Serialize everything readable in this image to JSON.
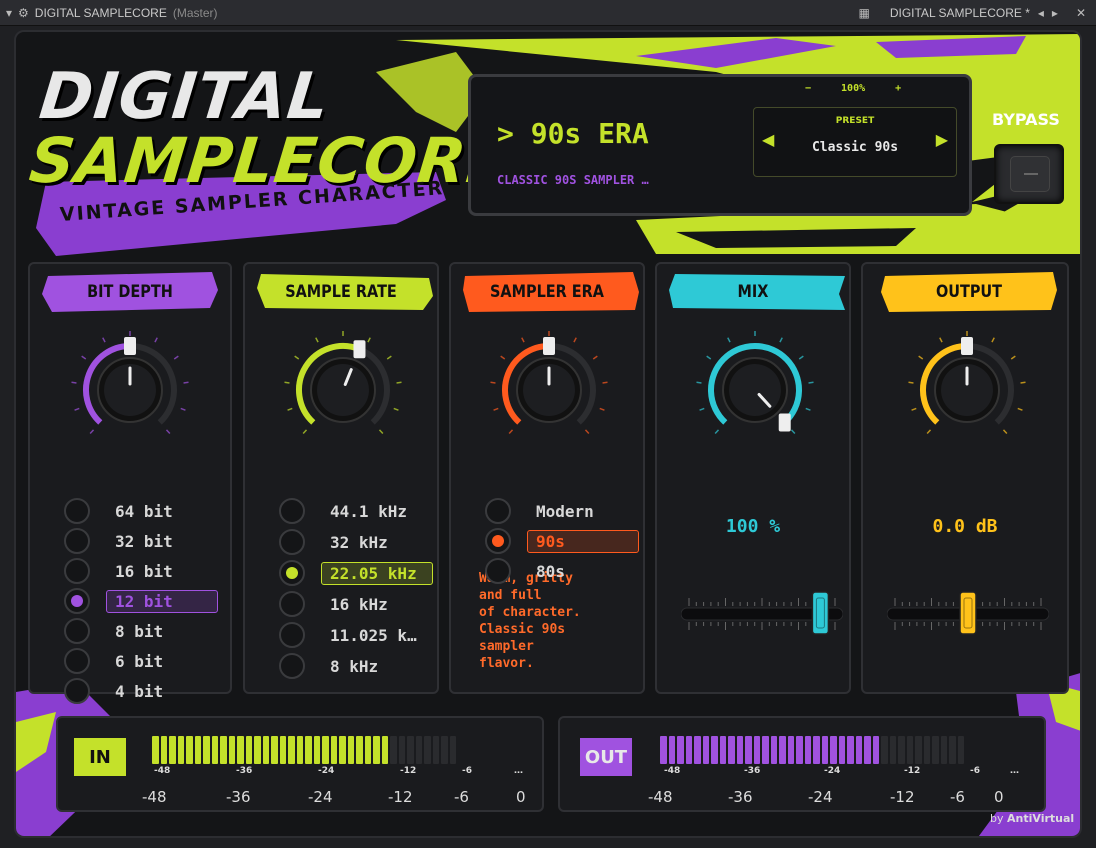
{
  "window": {
    "title": "DIGITAL SAMPLECORE",
    "title_suffix": "(Master)",
    "right_title": "DIGITAL SAMPLECORE *",
    "icons": [
      "menu-triangle-icon",
      "gear-icon",
      "grid-icon",
      "prev-arrow-icon",
      "next-arrow-icon",
      "close-icon"
    ]
  },
  "brand": {
    "line1": "DIGITAL",
    "line2": "SAMPLECORE",
    "tagline": "VINTAGE SAMPLER CHARACTER",
    "credit_prefix": "by ",
    "credit_name": "AntiVirtual"
  },
  "display": {
    "zoom_minus": "−",
    "zoom_value": "100%",
    "zoom_plus": "+",
    "era_title": "> 90s ERA",
    "era_subtitle": "CLASSIC 90S SAMPLER …",
    "preset_label": "PRESET",
    "preset_value": "Classic 90s"
  },
  "bypass": {
    "label": "BYPASS",
    "state": "off"
  },
  "colors": {
    "lime": "#c4e12a",
    "purple": "#a052e0",
    "orange": "#ff5a1e",
    "cyan": "#2ec9d6",
    "gold": "#ffc21a"
  },
  "panels": {
    "bit_depth": {
      "title": "BIT DEPTH",
      "knob_value": 0.5,
      "options": [
        "64 bit",
        "32 bit",
        "16 bit",
        "12 bit",
        "8 bit",
        "6 bit",
        "4 bit"
      ],
      "selected": 3
    },
    "sample_rate": {
      "title": "SAMPLE RATE",
      "knob_value": 0.58,
      "options": [
        "44.1 kHz",
        "32 kHz",
        "22.05 kHz",
        "16 kHz",
        "11.025 k…",
        "8 kHz"
      ],
      "selected": 2
    },
    "sampler_era": {
      "title": "SAMPLER ERA",
      "knob_value": 0.5,
      "options": [
        "Modern",
        "90s",
        "80s"
      ],
      "selected": 1,
      "description": [
        "Warm, gritty",
        "and full",
        "of character.",
        "Classic 90s",
        "sampler",
        "flavor."
      ]
    },
    "mix": {
      "title": "MIX",
      "knob_value": 1.0,
      "value_text": "100 %",
      "slider_value": 0.9
    },
    "output": {
      "title": "OUTPUT",
      "knob_value": 0.5,
      "value_text": "0.0 dB",
      "slider_value": 0.5
    }
  },
  "meters": {
    "in": {
      "label": "IN",
      "lit_fraction": 0.78
    },
    "out": {
      "label": "OUT",
      "lit_fraction": 0.72
    },
    "scale_small": [
      "-48",
      "-36",
      "-24",
      "-12",
      "-6",
      "…"
    ],
    "scale_big": [
      "-48",
      "-36",
      "-24",
      "-12",
      "-6",
      "0"
    ]
  }
}
